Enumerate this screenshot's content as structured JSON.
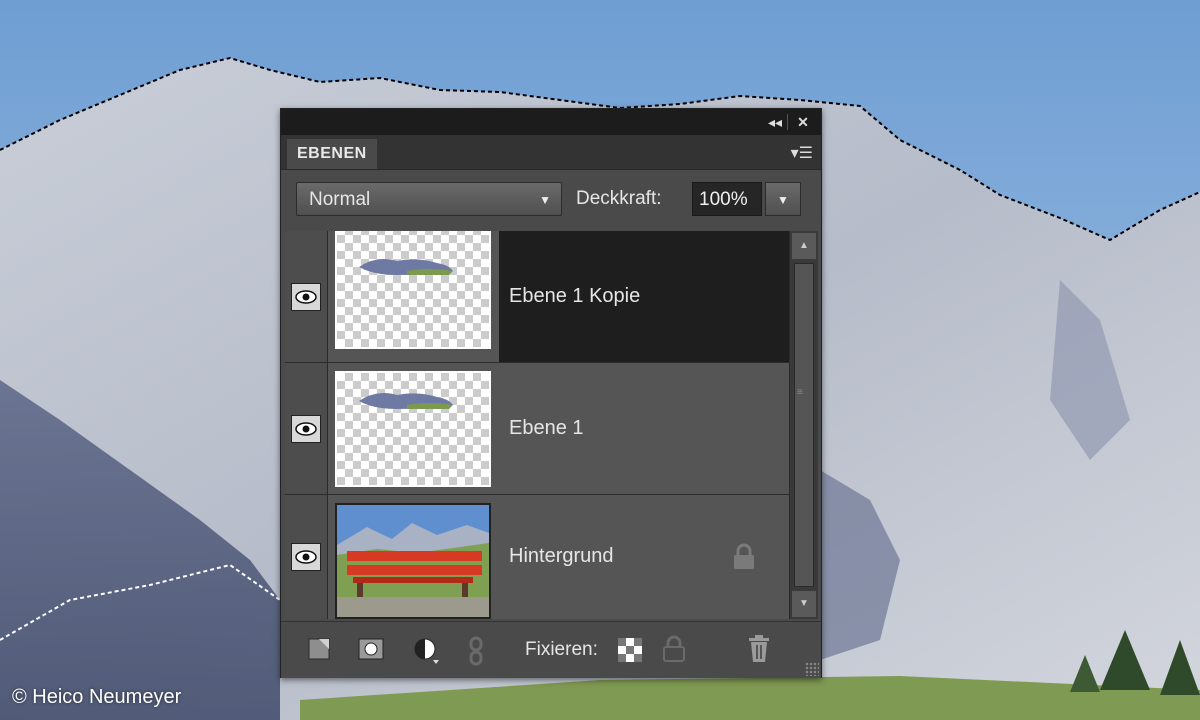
{
  "credit": "© Heico Neumeyer",
  "panel": {
    "tab_label": "EBENEN",
    "blend_mode": "Normal",
    "opacity_label": "Deckkraft:",
    "opacity_value": "100%",
    "fix_label": "Fixieren:"
  },
  "layers": [
    {
      "name": "Ebene 1 Kopie",
      "selected": true,
      "visible": true,
      "locked": false
    },
    {
      "name": "Ebene 1",
      "selected": false,
      "visible": true,
      "locked": false
    },
    {
      "name": "Hintergrund",
      "selected": false,
      "visible": true,
      "locked": true
    }
  ],
  "icons": {
    "collapse": "double-arrow-left-icon",
    "close": "close-icon",
    "panel_menu": "panel-menu-icon",
    "visibility": "eye-icon",
    "lock": "lock-icon",
    "new_layer": "new-layer-icon",
    "mask": "layer-mask-icon",
    "adjustment": "adjustment-layer-icon",
    "link": "link-icon",
    "lock_transparency": "lock-transparent-pixels-icon",
    "lock_all": "lock-all-icon",
    "delete": "trash-icon"
  }
}
